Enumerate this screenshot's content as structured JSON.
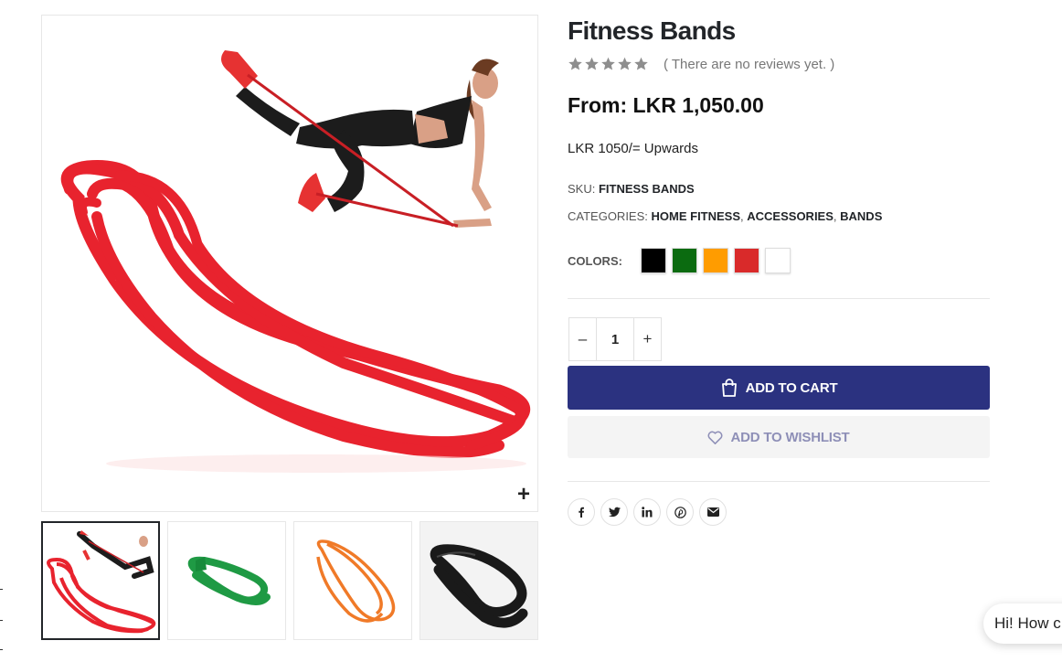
{
  "product": {
    "title": "Fitness Bands",
    "review_text": "( There are no reviews yet. )",
    "rating": 0,
    "rating_max": 5,
    "price": "From: LKR 1,050.00",
    "short_description": "LKR 1050/= Upwards",
    "sku_label": "SKU:",
    "sku_value": "FITNESS BANDS",
    "categories_label": "CATEGORIES:",
    "categories": [
      "HOME FITNESS",
      "ACCESSORIES",
      "BANDS"
    ],
    "category_separator": ", ",
    "colors_label": "COLORS:",
    "colors": [
      "#000000",
      "#0b6b10",
      "#ff9c00",
      "#d92a2a",
      "#ffffff"
    ]
  },
  "gallery": {
    "zoom_icon": "+",
    "thumbnails": [
      {
        "name": "red band with woman",
        "color": "#e0212b"
      },
      {
        "name": "green band",
        "color": "#1f9a44"
      },
      {
        "name": "orange band",
        "color": "#f07a28"
      },
      {
        "name": "black band",
        "color": "#1a1a1a"
      }
    ]
  },
  "cart": {
    "quantity": "1",
    "minus_label": "–",
    "plus_label": "+",
    "add_to_cart_label": "ADD TO CART",
    "wishlist_label": "ADD TO WISHLIST"
  },
  "share": {
    "networks": [
      "facebook",
      "twitter",
      "linkedin",
      "pinterest",
      "email"
    ]
  },
  "chat": {
    "text": "Hi! How c"
  },
  "colors": {
    "accent": "#2b3280",
    "wishlist_text": "#8e8fb7",
    "star": "#8e8e8e"
  }
}
